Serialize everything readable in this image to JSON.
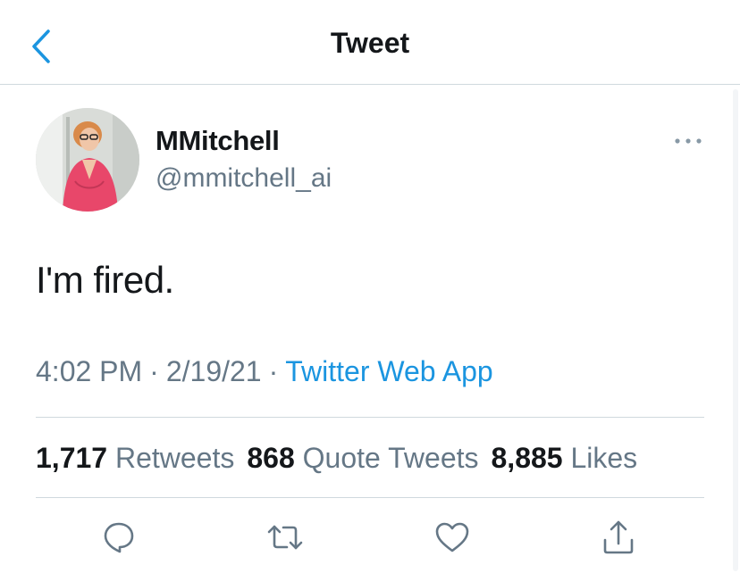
{
  "header": {
    "title": "Tweet",
    "back_icon": "chevron-left-icon"
  },
  "author": {
    "display_name": "MMitchell",
    "handle": "@mmitchell_ai",
    "more_icon": "more-horizontal-icon"
  },
  "tweet": {
    "text": "I'm fired.",
    "time": "4:02 PM",
    "separator": "·",
    "date": "2/19/21",
    "source": "Twitter Web App"
  },
  "stats": {
    "retweets_count": "1,717",
    "retweets_label": "Retweets",
    "quotes_count": "868",
    "quotes_label": "Quote Tweets",
    "likes_count": "8,885",
    "likes_label": "Likes"
  },
  "actions": {
    "reply_icon": "reply-icon",
    "retweet_icon": "retweet-icon",
    "like_icon": "heart-icon",
    "share_icon": "share-icon"
  },
  "colors": {
    "accent": "#1b95e0",
    "secondary_text": "#657786",
    "primary_text": "#14171a",
    "divider": "#cfd9de"
  }
}
